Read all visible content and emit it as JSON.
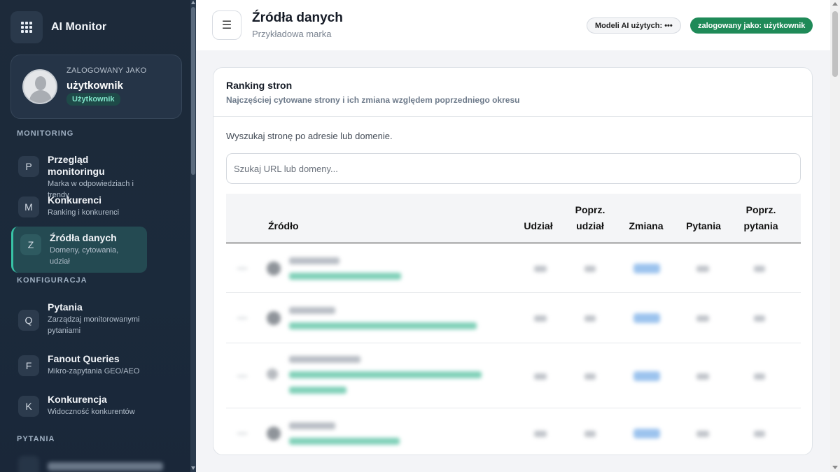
{
  "app": {
    "name": "AI Monitor"
  },
  "user_card": {
    "caption": "ZALOGOWANY JAKO",
    "name": "użytkownik",
    "role_badge": "Użytkownik"
  },
  "sidebar": {
    "sections": {
      "monitoring": "MONITORING",
      "configuration": "KONFIGURACJA",
      "questions": "PYTANIA"
    },
    "items": [
      {
        "letter": "P",
        "title": "Przegląd monitoringu",
        "subtitle": "Marka w odpowiedziach i trendy"
      },
      {
        "letter": "M",
        "title": "Konkurenci",
        "subtitle": "Ranking i konkurenci"
      },
      {
        "letter": "Z",
        "title": "Źródła danych",
        "subtitle": "Domeny, cytowania, udział",
        "active": true
      },
      {
        "letter": "Q",
        "title": "Pytania",
        "subtitle": "Zarządzaj monitorowanymi pytaniami"
      },
      {
        "letter": "F",
        "title": "Fanout Queries",
        "subtitle": "Mikro-zapytania GEO/AEO"
      },
      {
        "letter": "K",
        "title": "Konkurencja",
        "subtitle": "Widoczność konkurentów"
      }
    ]
  },
  "header": {
    "menu_icon": "☰",
    "title": "Źródła danych",
    "subtitle": "Przykładowa marka",
    "models_pill": "Modeli AI użytych: •••",
    "user_pill": "zalogowany jako: użytkownik"
  },
  "card": {
    "title": "Ranking stron",
    "subtitle": "Najczęściej cytowane strony i ich zmiana względem poprzedniego okresu",
    "search_label": "Wyszukaj stronę po adresie lub domenie.",
    "search_placeholder": "Szukaj URL lub domeny...",
    "search_value": ""
  },
  "table": {
    "columns": {
      "source": "Źródło",
      "share": "Udział",
      "prev_share": "Poprz. udział",
      "change": "Zmiana",
      "questions": "Pytania",
      "prev_questions": "Poprz. pytania"
    }
  },
  "colors": {
    "accent": "#1f8a58",
    "sidebar_bg": "#1d2a3a",
    "active_accent": "#38c3a6"
  }
}
